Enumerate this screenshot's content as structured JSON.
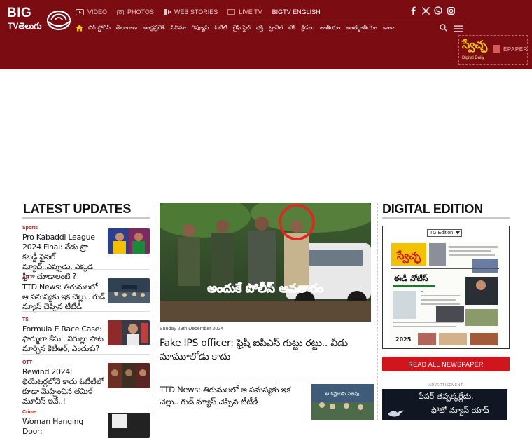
{
  "brand": {
    "logo_big": "BIG",
    "logo_tv": "TVతెలుగు"
  },
  "topnav": [
    {
      "label": "VIDEO",
      "icon": "video-icon"
    },
    {
      "label": "PHOTOS",
      "icon": "camera-icon"
    },
    {
      "label": "WEB STORIES",
      "icon": "web-stories-icon"
    },
    {
      "label": "LIVE TV",
      "icon": "tv-icon"
    },
    {
      "label": "BIGTV ENGLISH",
      "icon": ""
    }
  ],
  "social": [
    "facebook-icon",
    "x-icon",
    "whatsapp-icon",
    "instagram-icon"
  ],
  "mainnav": [
    "బిగ్ స్టోరీస్",
    "తెలంగాణ",
    "ఆంధ్రప్రదేశ్",
    "సినిమా",
    "రివ్యూస్",
    "ఓటీటీ",
    "లైఫ్ స్టైల్",
    "భక్తి",
    "ట్రావెల్",
    "టెక్",
    "క్రీడలు",
    "జాతీయం",
    "అంతర్జాతీయం",
    "ఇంకా"
  ],
  "epaper": {
    "masthead": "స్వేచ్ఛ",
    "tagline": "Digital Daily",
    "label": "EPAPER"
  },
  "latest": {
    "title": "LATEST UPDATES",
    "items": [
      {
        "category": "Sports",
        "headline": "Pro Kabaddi League 2024 Final: నేడు ప్రొ కబడ్డీ ఫైనల్ మ్యాచ్..ఎప్పుడు, ఎక్కడ ఫ్రీగా చూడాలంటే ?"
      },
      {
        "category": "AP",
        "headline": "TTD News: తిరుమలలో ఆ సమస్యకు ఇక చెల్లు.. గుడ్ న్యూస్ చెప్పిన టీటీడీ"
      },
      {
        "category": "TS",
        "headline": "Formula E Race Case: ఫార్ములా కేసు.. నిరుల్లు పాట మార్చిన కేటీఆర్, ఎందుకు?"
      },
      {
        "category": "OTT",
        "headline": "Rewind 2024: థియేటర్లలోనే కాదు ఓటీటీలో కూడా మెప్పించిన తమిళ్ మూవీస్ ఇవే..!"
      },
      {
        "category": "Crime",
        "headline": "Woman Hanging Door:"
      }
    ]
  },
  "hero": {
    "overlay_text": "అందుకే పోలీస్ అవతారం",
    "date": "Sunday 29th December 2024",
    "title": "Fake IPS officer: ఫ్రెషీ ఐపీఎస్ గుట్టు రట్టు.. వీడు మామూలోడు కాదు"
  },
  "second": {
    "title": "TTD News: తిరుమలలో ఆ సమస్యకు ఇక చెల్లు.. గుడ్ న్యూస్ చెప్పిన టీటీడీ",
    "thumb_caption": "ఆ కష్టాలకు సెలవు"
  },
  "digital": {
    "title": "DIGITAL EDITION",
    "edition": "TG Edition",
    "paper_masthead": "స్వేచ్ఛ",
    "paper_headline": "ఈడీ నోటీస్",
    "paper_year": "2025",
    "button": "READ ALL NEWSPAPER",
    "advertisement": "ADVERTISEMENT",
    "ad_line1": "పేపర్ తప్పక్కర్లేదు.",
    "ad_line2": "ఫోటో న్యూస్ యాప్"
  },
  "colors": {
    "header_bg": "#7a0c12",
    "accent_red": "#d0161c",
    "category_red": "#b1171c"
  }
}
